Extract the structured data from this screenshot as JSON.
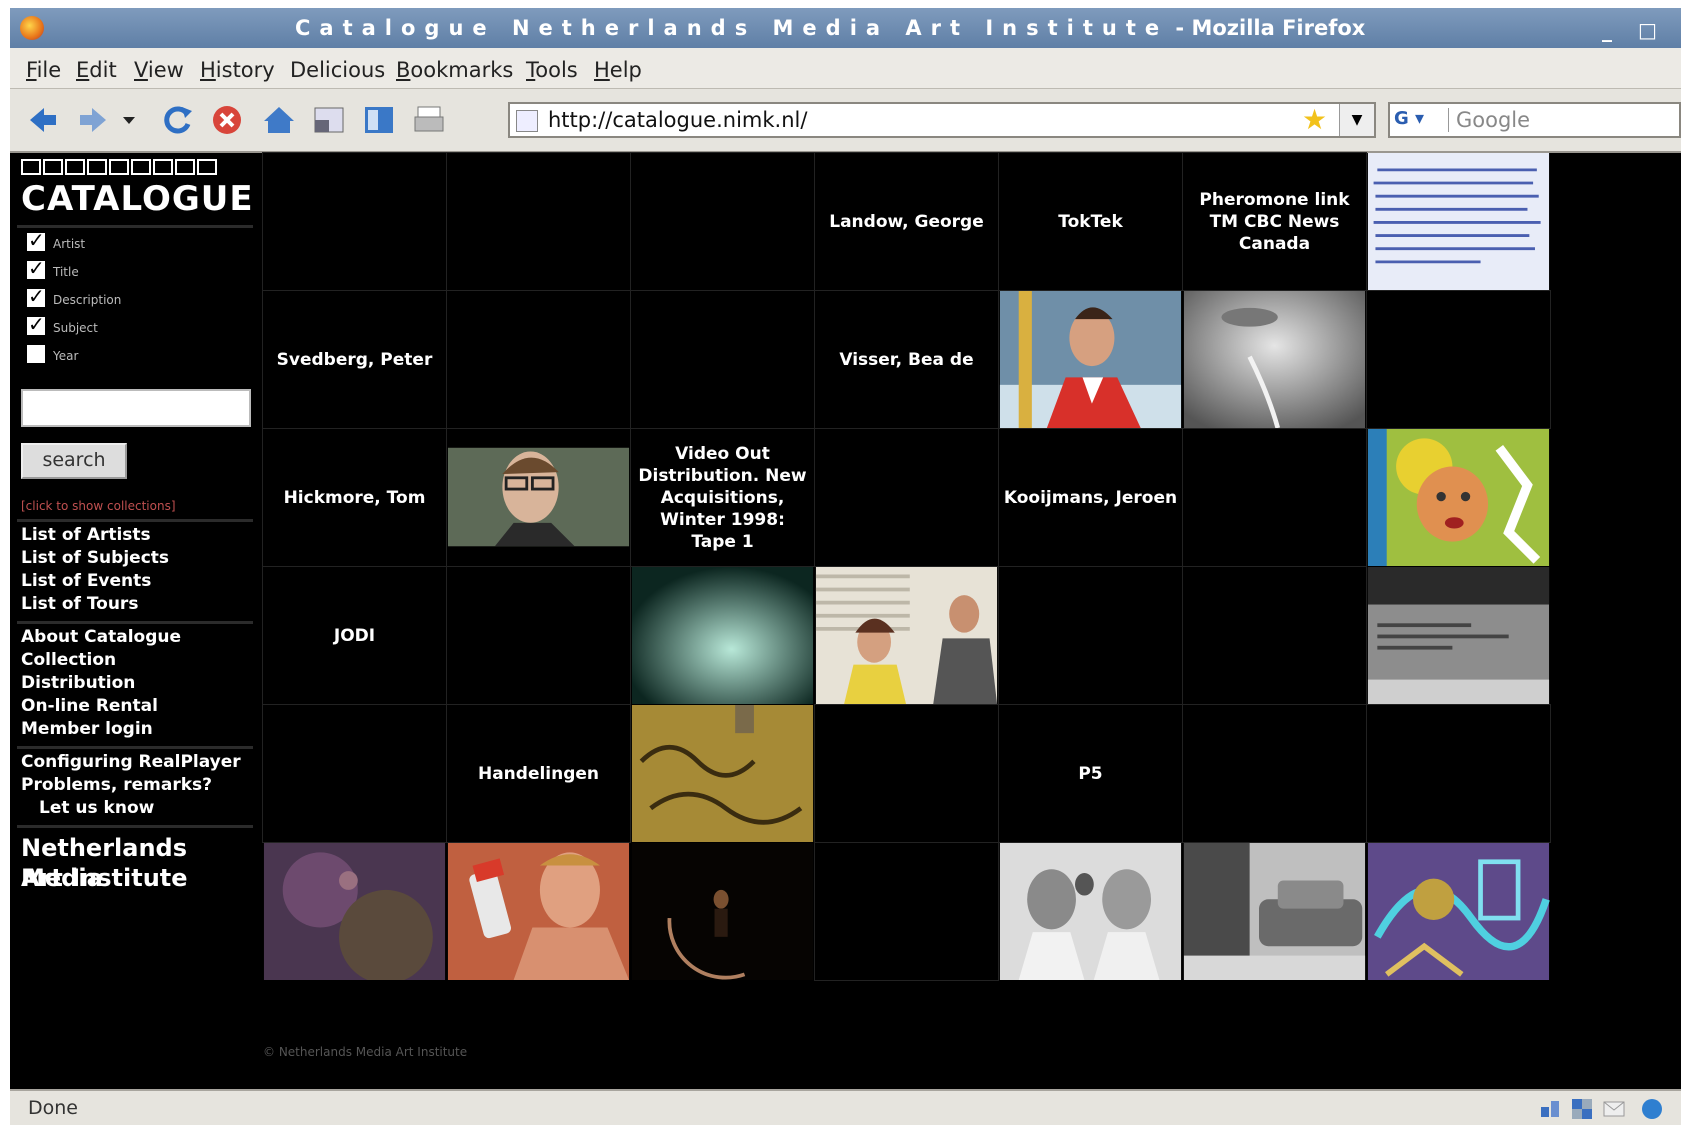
{
  "window": {
    "title_spaced": "Catalogue Netherlands Media Art Institute",
    "title_suffix": " - Mozilla Firefox",
    "controls": [
      "_",
      "□"
    ]
  },
  "menu": [
    {
      "label": "File",
      "accel": "F",
      "rest": "ile"
    },
    {
      "label": "Edit",
      "accel": "E",
      "rest": "dit"
    },
    {
      "label": "View",
      "accel": "V",
      "rest": "iew"
    },
    {
      "label": "History",
      "accel": "H",
      "rest": "istory"
    },
    {
      "label": "Delicious",
      "accel": "",
      "rest": "Delicious"
    },
    {
      "label": "Bookmarks",
      "accel": "B",
      "rest": "ookmarks"
    },
    {
      "label": "Tools",
      "accel": "T",
      "rest": "ools"
    },
    {
      "label": "Help",
      "accel": "H",
      "rest": "elp"
    }
  ],
  "toolbar": {
    "icons": [
      "back-icon",
      "forward-icon",
      "dropdown-icon",
      "reload-icon",
      "stop-icon",
      "home-icon",
      "window-icon",
      "sidebar-icon",
      "print-icon"
    ],
    "url": "http://catalogue.nimk.nl/",
    "search_placeholder": "Google",
    "search_engine": "G"
  },
  "sidebar": {
    "logo": "CATALOGUE",
    "filters": [
      {
        "label": "Artist",
        "checked": true
      },
      {
        "label": "Title",
        "checked": true
      },
      {
        "label": "Description",
        "checked": true
      },
      {
        "label": "Subject",
        "checked": true
      },
      {
        "label": "Year",
        "checked": false
      }
    ],
    "search_value": "",
    "search_button": "search",
    "collections_link": "[click to show collections]",
    "links_group1": [
      "List of Artists",
      "List of Subjects",
      "List of Events",
      "List of Tours"
    ],
    "links_group2": [
      "About Catalogue",
      "Collection",
      "Distribution",
      "On-line Rental",
      "Member login"
    ],
    "links_group3": [
      "Configuring RealPlayer",
      "Problems, remarks?",
      "Let us know"
    ],
    "institute": [
      "Netherlands Media",
      "Art Institute"
    ]
  },
  "grid": {
    "text_cells": [
      {
        "row": 0,
        "col": 3,
        "text": "Landow, George"
      },
      {
        "row": 0,
        "col": 4,
        "text": "TokTek"
      },
      {
        "row": 0,
        "col": 5,
        "text": "Pheromone link TM CBC News Canada"
      },
      {
        "row": 1,
        "col": 0,
        "text": "Svedberg, Peter"
      },
      {
        "row": 1,
        "col": 3,
        "text": "Visser, Bea de"
      },
      {
        "row": 2,
        "col": 0,
        "text": "Hickmore, Tom"
      },
      {
        "row": 2,
        "col": 2,
        "text": "Video Out Distribution. New Acquisitions, Winter 1998: Tape 1"
      },
      {
        "row": 2,
        "col": 4,
        "text": "Kooijmans, Jeroen"
      },
      {
        "row": 3,
        "col": 0,
        "text": "JODI"
      },
      {
        "row": 4,
        "col": 1,
        "text": "Handelingen"
      },
      {
        "row": 4,
        "col": 4,
        "text": "P5"
      }
    ],
    "thumbs": [
      {
        "row": 0,
        "col": 6,
        "name": "thumb-text-scan"
      },
      {
        "row": 1,
        "col": 4,
        "name": "thumb-skater"
      },
      {
        "row": 1,
        "col": 5,
        "name": "thumb-face-closeup"
      },
      {
        "row": 2,
        "col": 1,
        "name": "thumb-man-glasses"
      },
      {
        "row": 2,
        "col": 6,
        "name": "thumb-colorful-face"
      },
      {
        "row": 3,
        "col": 2,
        "name": "thumb-green-night"
      },
      {
        "row": 3,
        "col": 3,
        "name": "thumb-couple-window"
      },
      {
        "row": 3,
        "col": 6,
        "name": "thumb-grey-screen"
      },
      {
        "row": 4,
        "col": 2,
        "name": "thumb-yellow-graffiti"
      },
      {
        "row": 5,
        "col": 0,
        "name": "thumb-purple-texture"
      },
      {
        "row": 5,
        "col": 1,
        "name": "thumb-shirtless-man"
      },
      {
        "row": 5,
        "col": 2,
        "name": "thumb-dark-figure"
      },
      {
        "row": 5,
        "col": 4,
        "name": "thumb-two-heads"
      },
      {
        "row": 5,
        "col": 5,
        "name": "thumb-street-bw"
      },
      {
        "row": 5,
        "col": 6,
        "name": "thumb-cartoon"
      }
    ]
  },
  "footer": {
    "copyright": "© Netherlands Media Art Institute"
  },
  "status": {
    "text": "Done"
  }
}
